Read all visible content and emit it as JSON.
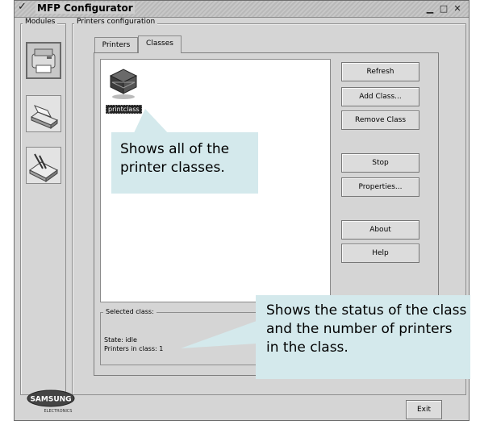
{
  "window": {
    "title": "MFP Configurator"
  },
  "modules": {
    "legend": "Modules",
    "items": [
      {
        "name": "printers-module",
        "icon": "printer-icon",
        "active": true
      },
      {
        "name": "scanners-module",
        "icon": "scanner-icon",
        "active": false
      },
      {
        "name": "ports-module",
        "icon": "port-icon",
        "active": false
      }
    ]
  },
  "printers_configuration": {
    "legend": "Printers configuration",
    "tabs": [
      {
        "label": "Printers",
        "active": false
      },
      {
        "label": "Classes",
        "active": true
      }
    ],
    "class_item": {
      "label": "printclass"
    },
    "buttons": {
      "refresh": "Refresh",
      "add_class": "Add Class...",
      "remove_class": "Remove Class",
      "stop": "Stop",
      "properties": "Properties...",
      "about": "About",
      "help": "Help"
    },
    "selected_class": {
      "legend": "Selected class:",
      "state": "State: idle",
      "printers_in_class": "Printers in class: 1"
    }
  },
  "callouts": {
    "classes": "Shows all of the printer classes.",
    "status": "Shows the status of the class and the number of printers in the class."
  },
  "logo": {
    "brand": "SAMSUNG",
    "sub": "ELECTRONICS"
  },
  "footer": {
    "exit": "Exit"
  },
  "colors": {
    "callout_bg": "#d4e9ec",
    "window_bg": "#d5d5d5"
  }
}
